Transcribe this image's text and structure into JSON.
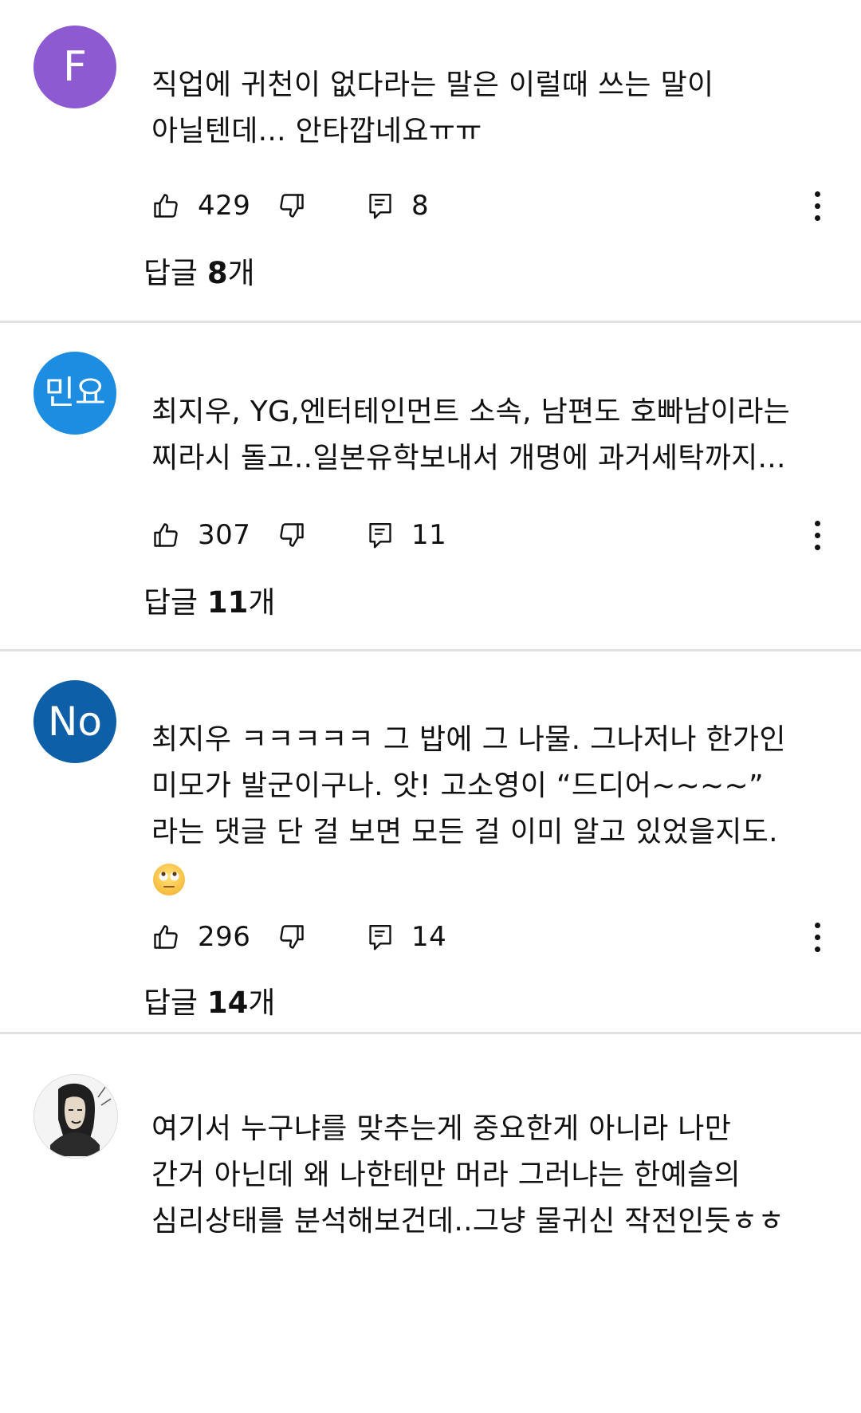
{
  "comments": [
    {
      "avatar_text": "F",
      "avatar_color": "#8e5ad1",
      "lines": [
        "직업에 귀천이 없다라는 말은 이럴때 쓰는 말이",
        "아닐텐데... 안타깝네요ㅠㅠ"
      ],
      "likes": "429",
      "reply_count": "8",
      "replies_prefix": "답글 ",
      "replies_num": "8",
      "replies_suffix": "개"
    },
    {
      "avatar_text": "민요",
      "avatar_color": "#1c8de0",
      "lines": [
        "최지우, YG,엔터테인먼트 소속, 남편도 호빠남이라는",
        "찌라시 돌고..일본유학보내서 개명에 과거세탁까지..."
      ],
      "likes": "307",
      "reply_count": "11",
      "replies_prefix": "답글 ",
      "replies_num": "11",
      "replies_suffix": "개"
    },
    {
      "avatar_text": "No",
      "avatar_color": "#0d5fa8",
      "lines": [
        "최지우 ㅋㅋㅋㅋㅋ 그 밥에 그 나물. 그나저나 한가인",
        "미모가 발군이구나. 앗! 고소영이 “드디어~~~~”",
        "라는 댓글 단 걸 보면 모든 걸 이미 알고 있었을지도."
      ],
      "emoji": "face-with-rolling-eyes",
      "likes": "296",
      "reply_count": "14",
      "replies_prefix": "답글 ",
      "replies_num": "14",
      "replies_suffix": "개"
    },
    {
      "avatar_image": "sketch-portrait",
      "lines": [
        "여기서 누구냐를 맞추는게 중요한게 아니라 나만",
        "간거 아닌데 왜 나한테만 머라 그러냐는 한예슬의",
        "심리상태를 분석해보건데..그냥 물귀신 작전인듯ㅎㅎ"
      ]
    }
  ],
  "icons": {
    "like": "thumbs-up-icon",
    "dislike": "thumbs-down-icon",
    "reply": "comment-reply-icon",
    "more": "more-vertical-icon"
  }
}
